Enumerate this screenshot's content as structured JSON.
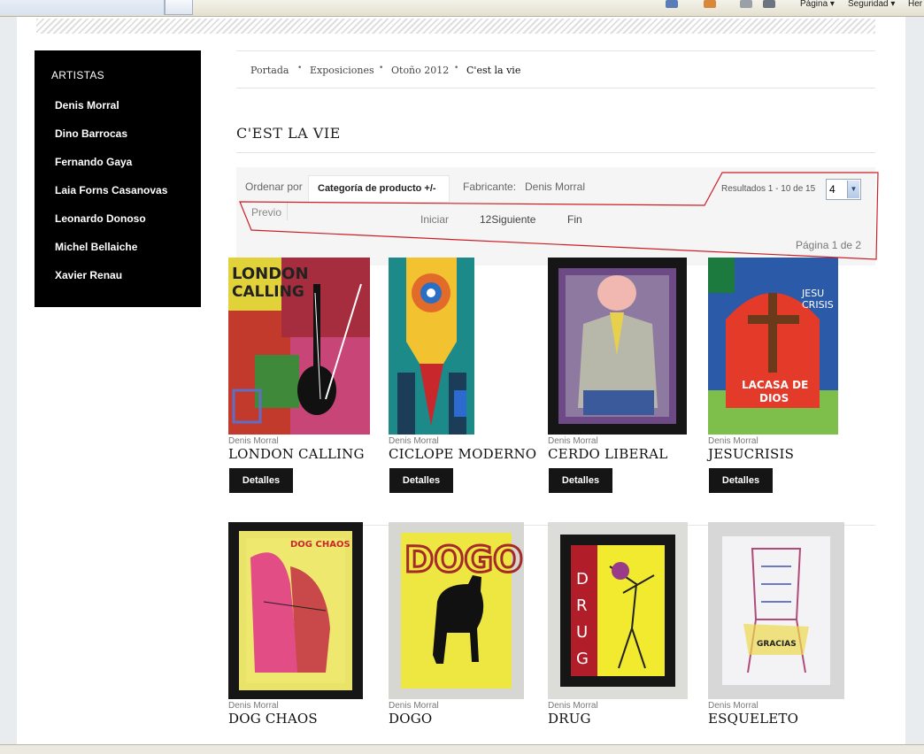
{
  "browser": {
    "commands": [
      "Página ▾",
      "Seguridad ▾",
      "Her"
    ]
  },
  "sidebar": {
    "title": "ARTISTAS",
    "items": [
      "Denis Morral",
      "Dino Barrocas",
      "Fernando Gaya",
      "Laia Forns Casanovas",
      "Leonardo Donoso",
      "Michel Bellaiche",
      "Xavier Renau"
    ]
  },
  "breadcrumb": [
    "Portada",
    "Exposiciones",
    "Otoño 2012",
    "C'est la vie"
  ],
  "page_title": "C'EST LA VIE",
  "toolbar": {
    "sort_label": "Ordenar por",
    "sort_value": "Categoría de producto +/-",
    "maker_label": "Fabricante:",
    "maker_value": "Denis Morral",
    "results_label": "Resultados 1 - 10 de 15",
    "results_value": "4",
    "prev": "Previo",
    "first": "Iniciar",
    "pages": "12Siguiente",
    "last": "Fin",
    "page_info": "Página 1 de 2"
  },
  "colors": {
    "annotation": "#cc1f26",
    "sidebar_bg": "#000000",
    "button_bg": "#151515"
  },
  "products": [
    {
      "maker": "Denis Morral",
      "name": "LONDON CALLING",
      "button": "Detalles"
    },
    {
      "maker": "Denis Morral",
      "name": "CICLOPE MODERNO",
      "button": "Detalles"
    },
    {
      "maker": "Denis Morral",
      "name": "CERDO LIBERAL",
      "button": "Detalles"
    },
    {
      "maker": "Denis Morral",
      "name": "JESUCRISIS",
      "button": "Detalles"
    },
    {
      "maker": "Denis Morral",
      "name": "DOG CHAOS"
    },
    {
      "maker": "Denis Morral",
      "name": "DOGO"
    },
    {
      "maker": "Denis Morral",
      "name": "DRUG"
    },
    {
      "maker": "Denis Morral",
      "name": "ESQUELETO"
    }
  ]
}
